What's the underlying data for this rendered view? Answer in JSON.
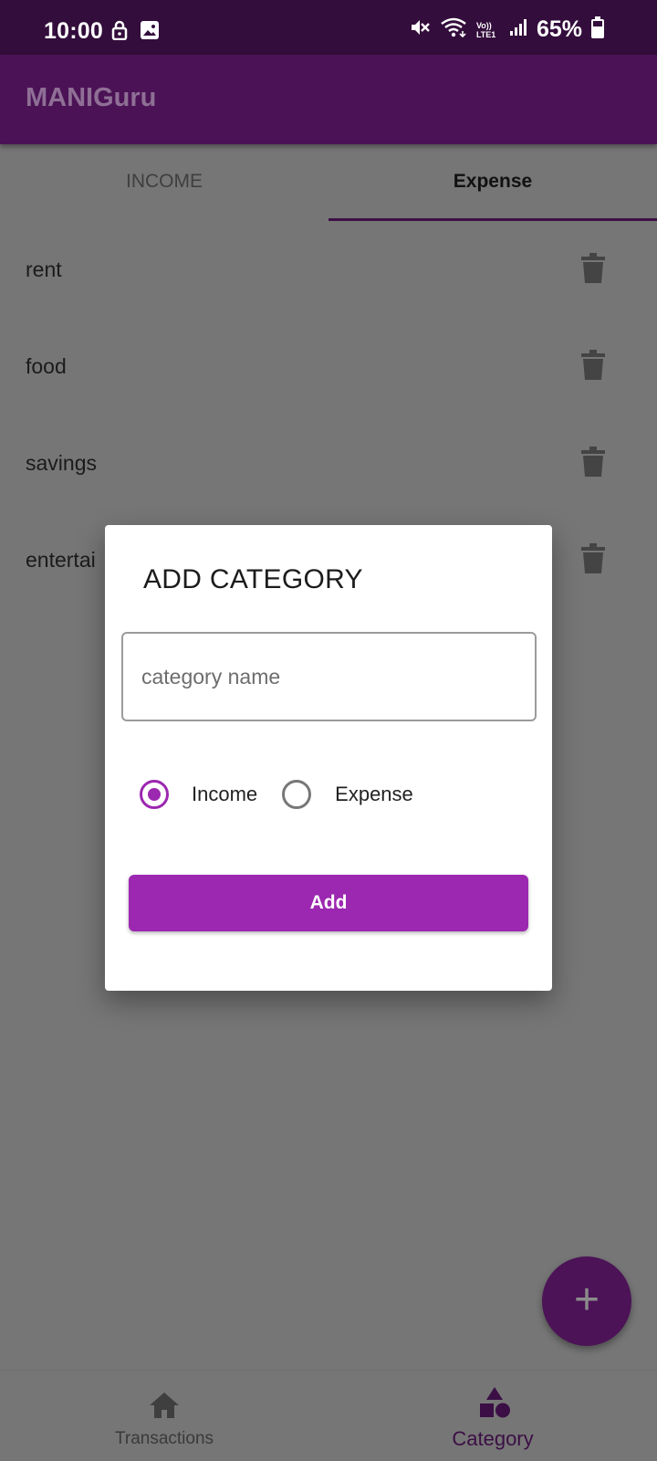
{
  "status_bar": {
    "time": "10:00",
    "battery_text": "65%",
    "network_text": "Vo)) LTE1",
    "icons": [
      "lock-icon",
      "image-icon",
      "mute-icon",
      "wifi-icon",
      "volte-icon",
      "signal-icon",
      "battery-icon"
    ]
  },
  "app_bar": {
    "title": "MANIGuru",
    "color": "#4b1356"
  },
  "tabs": [
    {
      "label": "INCOME",
      "selected": false
    },
    {
      "label": "Expense",
      "selected": true
    }
  ],
  "categories": [
    {
      "label": "rent"
    },
    {
      "label": "food"
    },
    {
      "label": "savings"
    },
    {
      "label": "entertai"
    }
  ],
  "fab": {
    "label": "+"
  },
  "bottom_nav": [
    {
      "label": "Transactions",
      "icon": "home-icon",
      "selected": false
    },
    {
      "label": "Category",
      "icon": "category-shapes-icon",
      "selected": true
    }
  ],
  "dialog": {
    "title": "ADD CATEGORY",
    "input": {
      "value": "",
      "placeholder": "category name"
    },
    "radio_options": [
      {
        "label": "Income",
        "selected": true
      },
      {
        "label": "Expense",
        "selected": false
      }
    ],
    "add_button_label": "Add",
    "accent_color": "#9c27b0"
  }
}
